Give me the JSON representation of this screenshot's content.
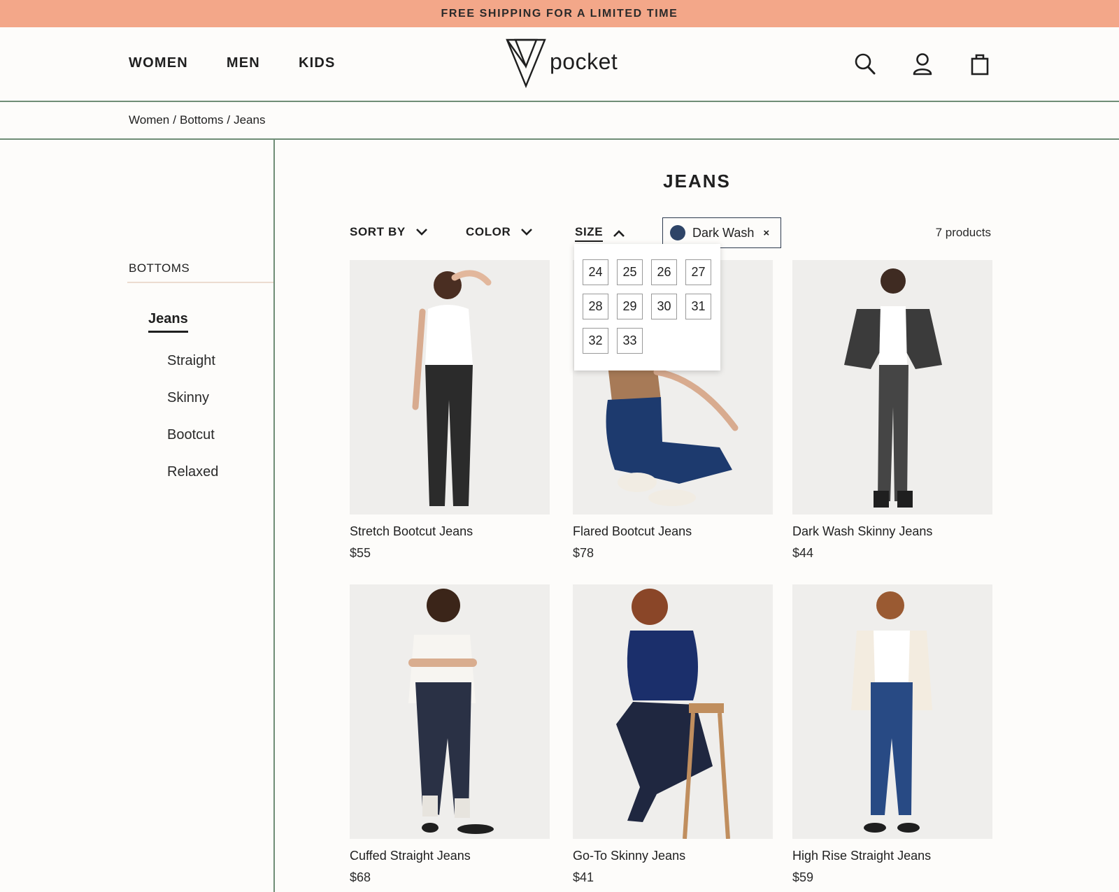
{
  "promo": {
    "text": "FREE SHIPPING FOR A LIMITED TIME"
  },
  "nav": {
    "items": [
      "WOMEN",
      "MEN",
      "KIDS"
    ]
  },
  "logo": {
    "text": "pocket"
  },
  "header_icons": [
    "search-icon",
    "account-icon",
    "shopping-bag-icon"
  ],
  "breadcrumb": {
    "items": [
      "Women",
      "Bottoms",
      "Jeans"
    ],
    "separator": "/"
  },
  "sidebar": {
    "title": "BOTTOMS",
    "active": "Jeans",
    "subitems": [
      "Straight",
      "Skinny",
      "Bootcut",
      "Relaxed"
    ]
  },
  "page_title": "JEANS",
  "filters": {
    "sort": "SORT BY",
    "color": "COLOR",
    "size": "SIZE",
    "active_chip": {
      "label": "Dark Wash",
      "color": "#2e4467",
      "remove": "×"
    },
    "count": "7 products"
  },
  "size_options": [
    "24",
    "25",
    "26",
    "27",
    "28",
    "29",
    "30",
    "31",
    "32",
    "33"
  ],
  "products": [
    {
      "name": "Stretch Bootcut Jeans",
      "price": "$55"
    },
    {
      "name": "Flared Bootcut Jeans",
      "price": "$78"
    },
    {
      "name": "Dark Wash Skinny Jeans",
      "price": "$44"
    },
    {
      "name": "Cuffed Straight Jeans",
      "price": "$68"
    },
    {
      "name": "Go-To Skinny Jeans",
      "price": "$41"
    },
    {
      "name": "High Rise Straight Jeans",
      "price": "$59"
    }
  ],
  "colors": {
    "promo": "#f3a789",
    "divider": "#6f8d76",
    "chip_dot": "#2e4467"
  }
}
